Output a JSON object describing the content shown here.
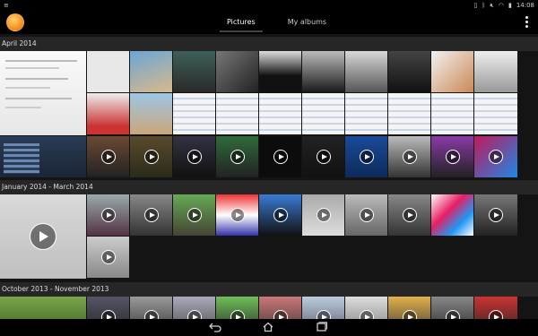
{
  "status": {
    "left_icon": "notification-icon",
    "time": "14:08",
    "icons": [
      "sim-icon",
      "bluetooth-icon",
      "mute-icon",
      "wifi-icon",
      "battery-icon"
    ]
  },
  "appbar": {
    "tabs": [
      {
        "label": "Pictures",
        "active": true
      },
      {
        "label": "My albums",
        "active": false
      }
    ]
  },
  "sections": [
    {
      "label": "April 2014"
    },
    {
      "label": "January 2014 - March 2014"
    },
    {
      "label": "October 2013 - November 2013"
    }
  ],
  "colors": {
    "background": "#141414",
    "section_bg": "#262626",
    "accent": "#f08a14"
  }
}
